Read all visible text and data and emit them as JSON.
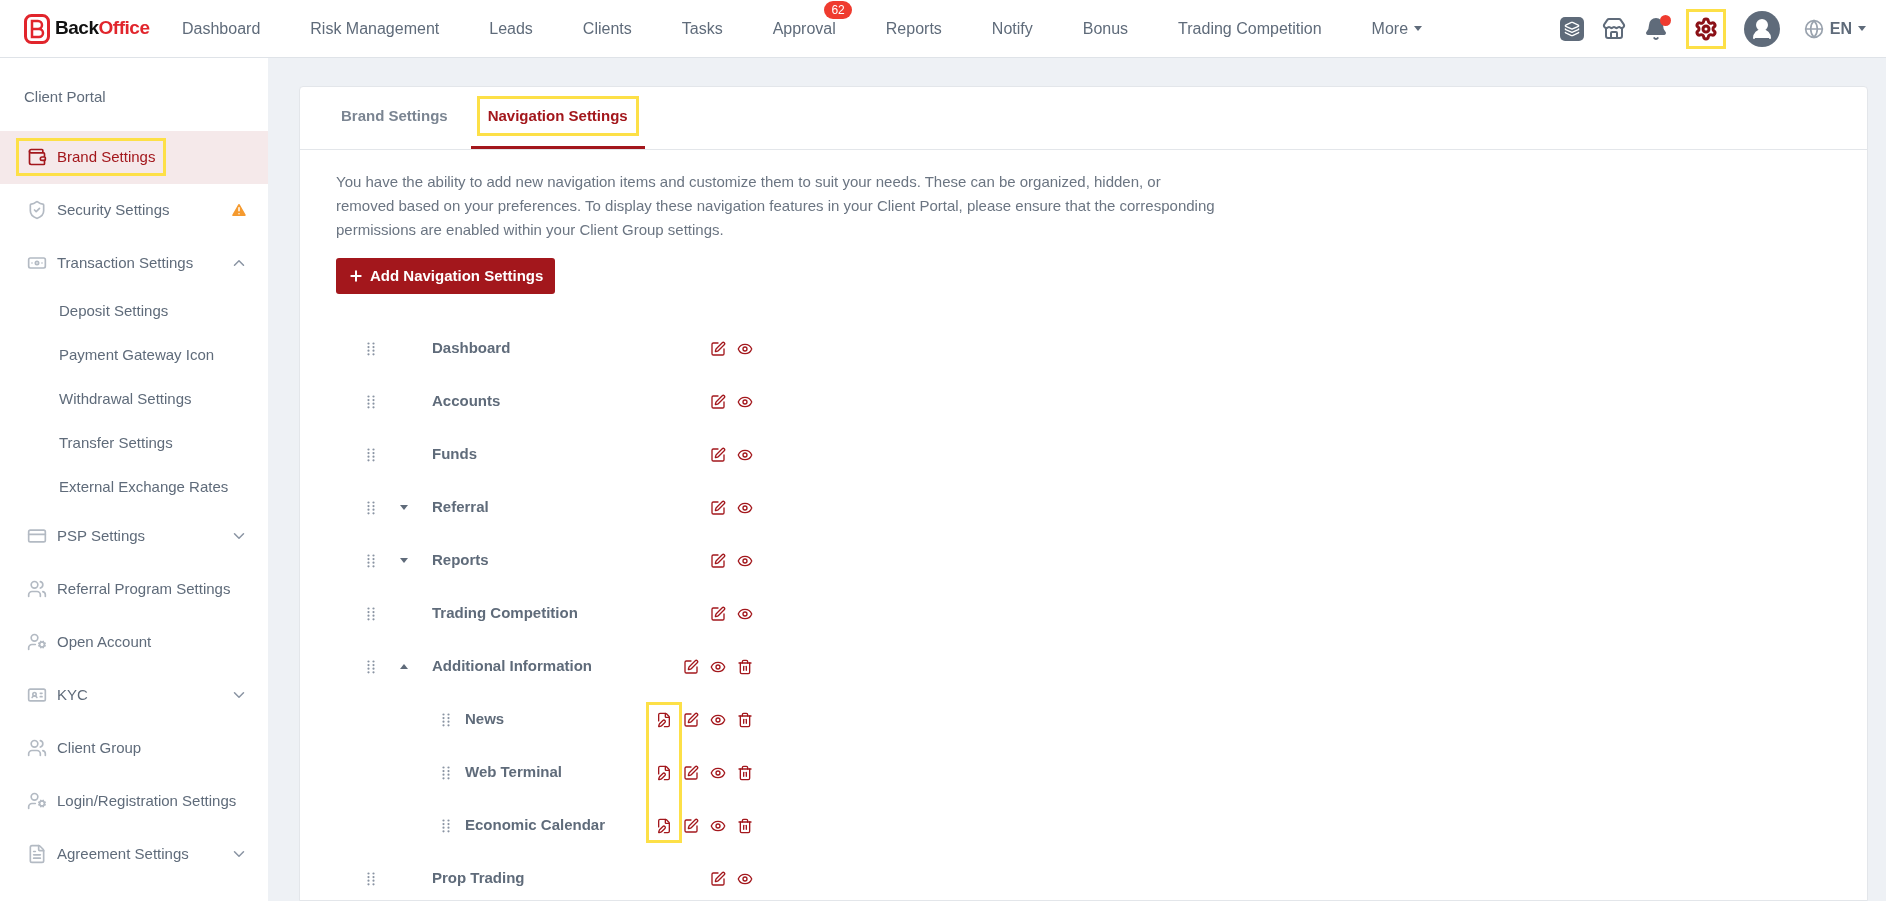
{
  "brand": {
    "first": "Back",
    "second": "Office"
  },
  "top_nav": [
    {
      "label": "Dashboard"
    },
    {
      "label": "Risk Management"
    },
    {
      "label": "Leads"
    },
    {
      "label": "Clients"
    },
    {
      "label": "Tasks"
    },
    {
      "label": "Approval",
      "badge": "62"
    },
    {
      "label": "Reports"
    },
    {
      "label": "Notify"
    },
    {
      "label": "Bonus"
    },
    {
      "label": "Trading Competition"
    },
    {
      "label": "More",
      "dropdown": true
    }
  ],
  "top_right": {
    "notification_dot": true,
    "settings_highlighted": true,
    "language": "EN"
  },
  "sidebar": {
    "heading": "Client Portal",
    "items": [
      {
        "label": "Brand Settings",
        "selected": true,
        "highlighted": true
      },
      {
        "label": "Security Settings",
        "selected": false,
        "warning": true
      },
      {
        "label": "Transaction Settings",
        "selected": false,
        "expanded": true,
        "children": [
          {
            "label": "Deposit Settings"
          },
          {
            "label": "Payment Gateway Icon"
          },
          {
            "label": "Withdrawal Settings"
          },
          {
            "label": "Transfer Settings"
          },
          {
            "label": "External Exchange Rates"
          }
        ]
      },
      {
        "label": "PSP Settings",
        "selected": false,
        "expanded": false
      },
      {
        "label": "Referral Program Settings",
        "selected": false
      },
      {
        "label": "Open Account",
        "selected": false
      },
      {
        "label": "KYC",
        "selected": false,
        "expanded": false
      },
      {
        "label": "Client Group",
        "selected": false
      },
      {
        "label": "Login/Registration Settings",
        "selected": false
      },
      {
        "label": "Agreement Settings",
        "selected": false,
        "expanded": false
      }
    ]
  },
  "tabs": [
    {
      "label": "Brand Settings",
      "selected": false,
      "highlighted": false
    },
    {
      "label": "Navigation Settings",
      "selected": true,
      "highlighted": true
    }
  ],
  "description": "You have the ability to add new navigation items and customize them to suit your needs. These can be organized, hidden, or removed based on your preferences. To display these navigation features in your Client Portal, please ensure that the corresponding permissions are enabled within your Client Group settings.",
  "add_button": "Add Navigation Settings",
  "nav_items": [
    {
      "label": "Dashboard",
      "kind": "builtin"
    },
    {
      "label": "Accounts",
      "kind": "builtin"
    },
    {
      "label": "Funds",
      "kind": "builtin"
    },
    {
      "label": "Referral",
      "kind": "builtin",
      "expanded": false
    },
    {
      "label": "Reports",
      "kind": "builtin",
      "expanded": false
    },
    {
      "label": "Trading Competition",
      "kind": "builtin"
    },
    {
      "label": "Additional Information",
      "kind": "custom",
      "expanded": true,
      "notes_highlighted": true,
      "children": [
        {
          "label": "News",
          "kind": "page"
        },
        {
          "label": "Web Terminal",
          "kind": "page"
        },
        {
          "label": "Economic Calendar",
          "kind": "page"
        }
      ]
    },
    {
      "label": "Prop Trading",
      "kind": "builtin"
    }
  ]
}
